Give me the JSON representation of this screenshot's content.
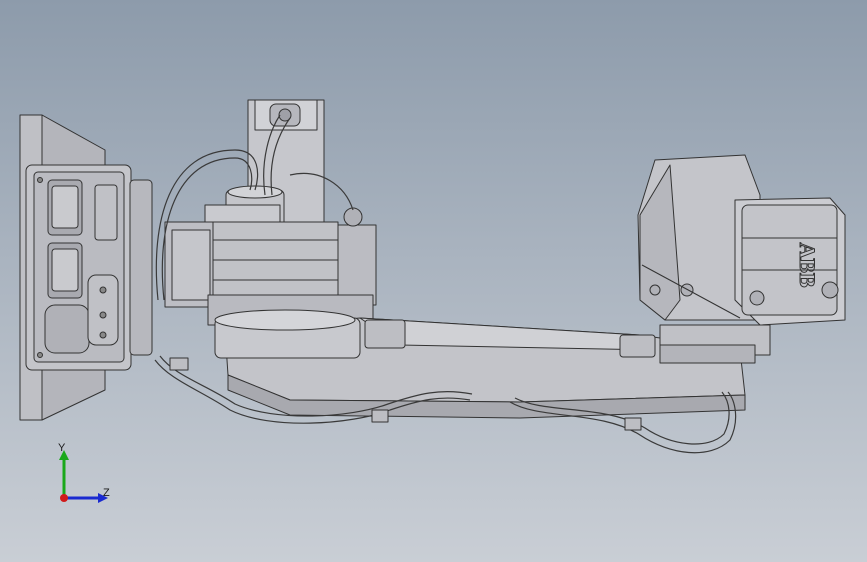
{
  "viewport": {
    "background_top": "#8d9bab",
    "background_bottom": "#c9ced5",
    "edge_color": "#333333",
    "face_color": "#c8c8cc"
  },
  "model": {
    "brand_logo": "ABB"
  },
  "triad": {
    "y_label": "Y",
    "z_label": "Z",
    "y_color": "#1aa81a",
    "z_color": "#1a2ad0",
    "x_color": "#d01a1a"
  }
}
